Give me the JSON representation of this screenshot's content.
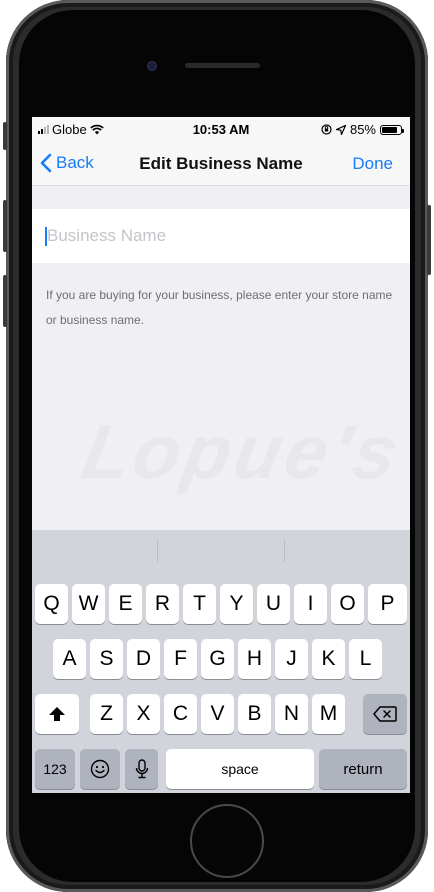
{
  "status_bar": {
    "carrier": "Globe",
    "time": "10:53 AM",
    "battery": "85%"
  },
  "nav": {
    "back_label": "Back",
    "title": "Edit Business Name",
    "done_label": "Done"
  },
  "form": {
    "business_name_placeholder": "Business Name",
    "business_name_value": "",
    "helper_text": "If you are buying for your business, please enter your store name or business name."
  },
  "watermark": "Lopue's",
  "keyboard": {
    "row1": [
      "Q",
      "W",
      "E",
      "R",
      "T",
      "Y",
      "U",
      "I",
      "O",
      "P"
    ],
    "row2": [
      "A",
      "S",
      "D",
      "F",
      "G",
      "H",
      "J",
      "K",
      "L"
    ],
    "row3": [
      "Z",
      "X",
      "C",
      "V",
      "B",
      "N",
      "M"
    ],
    "numbers_label": "123",
    "space_label": "space",
    "return_label": "return"
  },
  "colors": {
    "accent": "#1a7cf5",
    "screen_bg": "#efeff4",
    "keyboard_bg": "#d1d4da"
  }
}
